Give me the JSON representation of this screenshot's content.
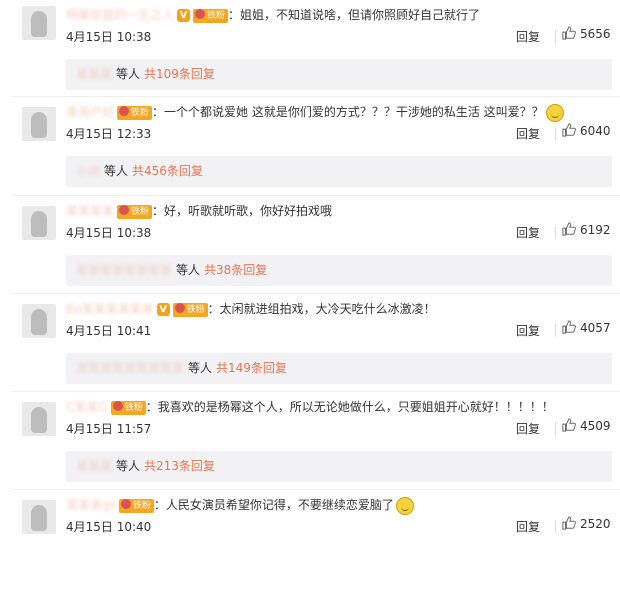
{
  "comments": [
    {
      "username": "杨幂是我的一生之人",
      "verified": true,
      "fan_badge": "铁粉",
      "text": "：姐姐，不知道说啥，但请你照顾好自己就行了",
      "emoji": false,
      "date": "4月15日 10:38",
      "reply_label": "回复",
      "likes": "5656",
      "reply_summary": {
        "names": "某某某",
        "deng": "等人",
        "link": "共109条回复"
      }
    },
    {
      "username": "某用户好",
      "verified": false,
      "fan_badge": "铁粉",
      "text": "：一个个都说爱她 这就是你们爱的方式？？？干涉她的私生活 这叫爱？？",
      "emoji": true,
      "date": "4月15日 12:33",
      "reply_label": "回复",
      "likes": "6040",
      "reply_summary": {
        "names": "小流",
        "deng": "等人",
        "link": "共456条回复"
      }
    },
    {
      "username": "某某某某",
      "verified": false,
      "fan_badge": "铁粉",
      "text": "：好，听歌就听歌，你好好拍戏哦",
      "emoji": false,
      "date": "4月15日 10:38",
      "reply_label": "回复",
      "likes": "6192",
      "reply_summary": {
        "names": "某某某某某某某某",
        "deng": "等人",
        "link": "共38条回复"
      }
    },
    {
      "username": "Bo某某某某某某",
      "verified": true,
      "fan_badge": "铁粉",
      "text": "：太闲就进组拍戏，大冷天吃什么冰激凌！",
      "emoji": false,
      "date": "4月15日 10:41",
      "reply_label": "回复",
      "likes": "4057",
      "reply_summary": {
        "names": "某某某某某某某某某",
        "deng": "等人",
        "link": "共149条回复"
      }
    },
    {
      "username": "C某某G",
      "verified": false,
      "fan_badge": "铁粉",
      "text": "：我喜欢的是杨幂这个人，所以无论她做什么，只要姐姐开心就好！！！！！",
      "emoji": false,
      "date": "4月15日 11:57",
      "reply_label": "回复",
      "likes": "4509",
      "reply_summary": {
        "names": "某某某",
        "deng": "等人",
        "link": "共213条回复"
      }
    },
    {
      "username": "某某某gs",
      "verified": false,
      "fan_badge": "铁粉",
      "text": "：人民女演员希望你记得，不要继续恋爱脑了",
      "emoji": true,
      "date": "4月15日 10:40",
      "reply_label": "回复",
      "likes": "2520",
      "reply_summary": null
    }
  ]
}
